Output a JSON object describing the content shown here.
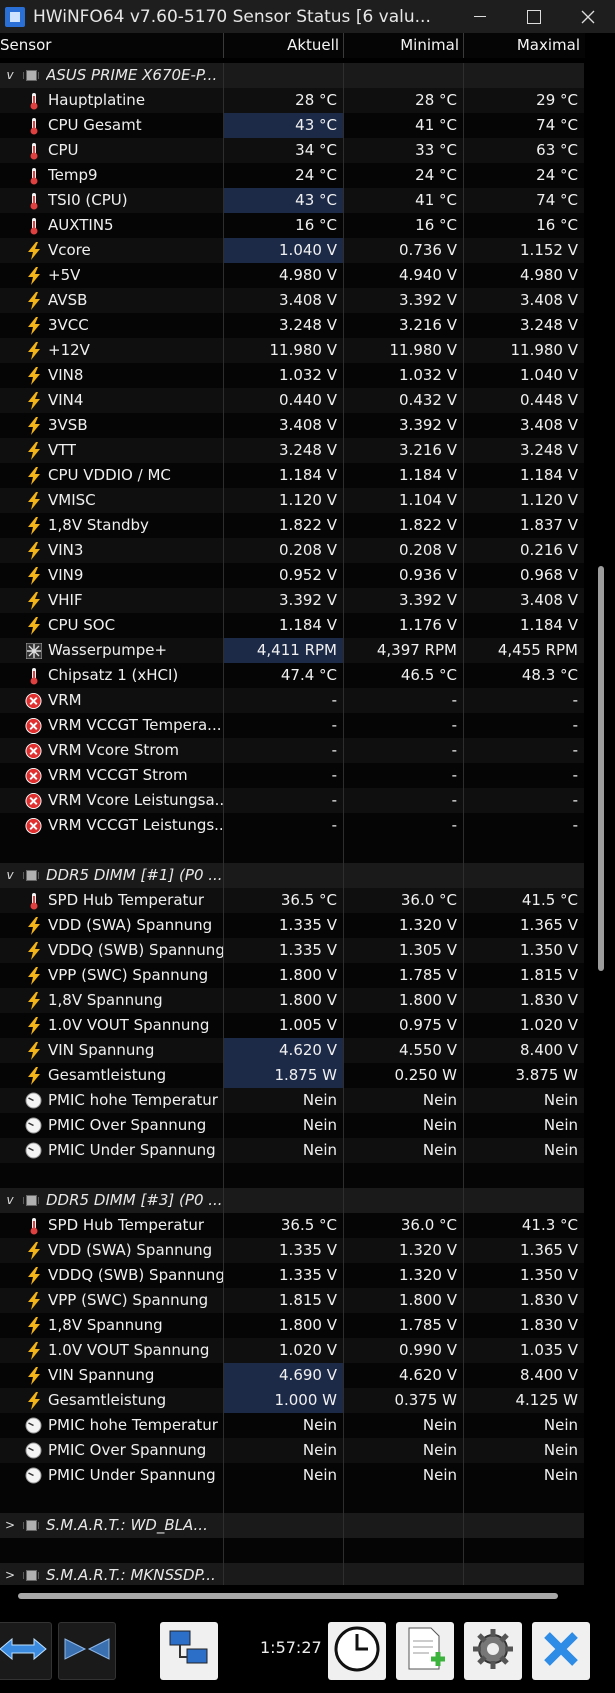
{
  "window": {
    "title": "HWiNFO64 v7.60-5170 Sensor Status [6 valu..."
  },
  "columns": [
    "Sensor",
    "Aktuell",
    "Minimal",
    "Maximal"
  ],
  "rows": [
    {
      "type": "group",
      "toggle": "v",
      "label": "ASUS PRIME X670E-P..."
    },
    {
      "type": "sensor",
      "icon": "thermometer-icon",
      "label": "Hauptplatine",
      "cur": "28 °C",
      "min": "28 °C",
      "max": "29 °C"
    },
    {
      "type": "sensor",
      "icon": "thermometer-icon",
      "label": "CPU Gesamt",
      "cur": "43 °C",
      "min": "41 °C",
      "max": "74 °C",
      "hl": true
    },
    {
      "type": "sensor",
      "icon": "thermometer-icon",
      "label": "CPU",
      "cur": "34 °C",
      "min": "33 °C",
      "max": "63 °C"
    },
    {
      "type": "sensor",
      "icon": "thermometer-icon",
      "label": "Temp9",
      "cur": "24 °C",
      "min": "24 °C",
      "max": "24 °C"
    },
    {
      "type": "sensor",
      "icon": "thermometer-icon",
      "label": "TSI0 (CPU)",
      "cur": "43 °C",
      "min": "41 °C",
      "max": "74 °C",
      "hl": true
    },
    {
      "type": "sensor",
      "icon": "thermometer-icon",
      "label": "AUXTIN5",
      "cur": "16 °C",
      "min": "16 °C",
      "max": "16 °C"
    },
    {
      "type": "sensor",
      "icon": "lightning-icon",
      "label": "Vcore",
      "cur": "1.040 V",
      "min": "0.736 V",
      "max": "1.152 V",
      "hl": true
    },
    {
      "type": "sensor",
      "icon": "lightning-icon",
      "label": "+5V",
      "cur": "4.980 V",
      "min": "4.940 V",
      "max": "4.980 V"
    },
    {
      "type": "sensor",
      "icon": "lightning-icon",
      "label": "AVSB",
      "cur": "3.408 V",
      "min": "3.392 V",
      "max": "3.408 V"
    },
    {
      "type": "sensor",
      "icon": "lightning-icon",
      "label": "3VCC",
      "cur": "3.248 V",
      "min": "3.216 V",
      "max": "3.248 V"
    },
    {
      "type": "sensor",
      "icon": "lightning-icon",
      "label": "+12V",
      "cur": "11.980 V",
      "min": "11.980 V",
      "max": "11.980 V"
    },
    {
      "type": "sensor",
      "icon": "lightning-icon",
      "label": "VIN8",
      "cur": "1.032 V",
      "min": "1.032 V",
      "max": "1.040 V"
    },
    {
      "type": "sensor",
      "icon": "lightning-icon",
      "label": "VIN4",
      "cur": "0.440 V",
      "min": "0.432 V",
      "max": "0.448 V"
    },
    {
      "type": "sensor",
      "icon": "lightning-icon",
      "label": "3VSB",
      "cur": "3.408 V",
      "min": "3.392 V",
      "max": "3.408 V"
    },
    {
      "type": "sensor",
      "icon": "lightning-icon",
      "label": "VTT",
      "cur": "3.248 V",
      "min": "3.216 V",
      "max": "3.248 V"
    },
    {
      "type": "sensor",
      "icon": "lightning-icon",
      "label": "CPU VDDIO / MC",
      "cur": "1.184 V",
      "min": "1.184 V",
      "max": "1.184 V"
    },
    {
      "type": "sensor",
      "icon": "lightning-icon",
      "label": "VMISC",
      "cur": "1.120 V",
      "min": "1.104 V",
      "max": "1.120 V"
    },
    {
      "type": "sensor",
      "icon": "lightning-icon",
      "label": "1,8V Standby",
      "cur": "1.822 V",
      "min": "1.822 V",
      "max": "1.837 V"
    },
    {
      "type": "sensor",
      "icon": "lightning-icon",
      "label": "VIN3",
      "cur": "0.208 V",
      "min": "0.208 V",
      "max": "0.216 V"
    },
    {
      "type": "sensor",
      "icon": "lightning-icon",
      "label": "VIN9",
      "cur": "0.952 V",
      "min": "0.936 V",
      "max": "0.968 V"
    },
    {
      "type": "sensor",
      "icon": "lightning-icon",
      "label": "VHIF",
      "cur": "3.392 V",
      "min": "3.392 V",
      "max": "3.408 V"
    },
    {
      "type": "sensor",
      "icon": "lightning-icon",
      "label": "CPU SOC",
      "cur": "1.184 V",
      "min": "1.176 V",
      "max": "1.184 V"
    },
    {
      "type": "sensor",
      "icon": "fan-icon",
      "label": "Wasserpumpe+",
      "cur": "4,411 RPM",
      "min": "4,397 RPM",
      "max": "4,455 RPM",
      "hl": true
    },
    {
      "type": "sensor",
      "icon": "thermometer-icon",
      "label": "Chipsatz 1 (xHCI)",
      "cur": "47.4 °C",
      "min": "46.5 °C",
      "max": "48.3 °C"
    },
    {
      "type": "sensor",
      "icon": "error-icon",
      "label": "VRM",
      "cur": "-",
      "min": "-",
      "max": "-"
    },
    {
      "type": "sensor",
      "icon": "error-icon",
      "label": "VRM VCCGT Tempera...",
      "cur": "-",
      "min": "-",
      "max": "-"
    },
    {
      "type": "sensor",
      "icon": "error-icon",
      "label": "VRM Vcore Strom",
      "cur": "-",
      "min": "-",
      "max": "-"
    },
    {
      "type": "sensor",
      "icon": "error-icon",
      "label": "VRM VCCGT Strom",
      "cur": "-",
      "min": "-",
      "max": "-"
    },
    {
      "type": "sensor",
      "icon": "error-icon",
      "label": "VRM Vcore Leistungsa...",
      "cur": "-",
      "min": "-",
      "max": "-"
    },
    {
      "type": "sensor",
      "icon": "error-icon",
      "label": "VRM VCCGT Leistungs...",
      "cur": "-",
      "min": "-",
      "max": "-"
    },
    {
      "type": "blank"
    },
    {
      "type": "group",
      "toggle": "v",
      "label": "DDR5 DIMM [#1] (P0 ..."
    },
    {
      "type": "sensor",
      "icon": "thermometer-icon",
      "label": "SPD Hub Temperatur",
      "cur": "36.5 °C",
      "min": "36.0 °C",
      "max": "41.5 °C"
    },
    {
      "type": "sensor",
      "icon": "lightning-icon",
      "label": "VDD (SWA) Spannung",
      "cur": "1.335 V",
      "min": "1.320 V",
      "max": "1.365 V"
    },
    {
      "type": "sensor",
      "icon": "lightning-icon",
      "label": "VDDQ (SWB) Spannung",
      "cur": "1.335 V",
      "min": "1.305 V",
      "max": "1.350 V"
    },
    {
      "type": "sensor",
      "icon": "lightning-icon",
      "label": "VPP (SWC) Spannung",
      "cur": "1.800 V",
      "min": "1.785 V",
      "max": "1.815 V"
    },
    {
      "type": "sensor",
      "icon": "lightning-icon",
      "label": "1,8V Spannung",
      "cur": "1.800 V",
      "min": "1.800 V",
      "max": "1.830 V"
    },
    {
      "type": "sensor",
      "icon": "lightning-icon",
      "label": "1.0V VOUT Spannung",
      "cur": "1.005 V",
      "min": "0.975 V",
      "max": "1.020 V"
    },
    {
      "type": "sensor",
      "icon": "lightning-icon",
      "label": "VIN Spannung",
      "cur": "4.620 V",
      "min": "4.550 V",
      "max": "8.400 V",
      "hl": true
    },
    {
      "type": "sensor",
      "icon": "lightning-icon",
      "label": "Gesamtleistung",
      "cur": "1.875 W",
      "min": "0.250 W",
      "max": "3.875 W",
      "hl": true
    },
    {
      "type": "sensor",
      "icon": "gauge-icon",
      "label": "PMIC hohe Temperatur",
      "cur": "Nein",
      "min": "Nein",
      "max": "Nein"
    },
    {
      "type": "sensor",
      "icon": "gauge-icon",
      "label": "PMIC Over Spannung",
      "cur": "Nein",
      "min": "Nein",
      "max": "Nein"
    },
    {
      "type": "sensor",
      "icon": "gauge-icon",
      "label": "PMIC Under Spannung",
      "cur": "Nein",
      "min": "Nein",
      "max": "Nein"
    },
    {
      "type": "blank"
    },
    {
      "type": "group",
      "toggle": "v",
      "label": "DDR5 DIMM [#3] (P0 ..."
    },
    {
      "type": "sensor",
      "icon": "thermometer-icon",
      "label": "SPD Hub Temperatur",
      "cur": "36.5 °C",
      "min": "36.0 °C",
      "max": "41.3 °C"
    },
    {
      "type": "sensor",
      "icon": "lightning-icon",
      "label": "VDD (SWA) Spannung",
      "cur": "1.335 V",
      "min": "1.320 V",
      "max": "1.365 V"
    },
    {
      "type": "sensor",
      "icon": "lightning-icon",
      "label": "VDDQ (SWB) Spannung",
      "cur": "1.335 V",
      "min": "1.320 V",
      "max": "1.350 V"
    },
    {
      "type": "sensor",
      "icon": "lightning-icon",
      "label": "VPP (SWC) Spannung",
      "cur": "1.815 V",
      "min": "1.800 V",
      "max": "1.830 V"
    },
    {
      "type": "sensor",
      "icon": "lightning-icon",
      "label": "1,8V Spannung",
      "cur": "1.800 V",
      "min": "1.785 V",
      "max": "1.830 V"
    },
    {
      "type": "sensor",
      "icon": "lightning-icon",
      "label": "1.0V VOUT Spannung",
      "cur": "1.020 V",
      "min": "0.990 V",
      "max": "1.035 V"
    },
    {
      "type": "sensor",
      "icon": "lightning-icon",
      "label": "VIN Spannung",
      "cur": "4.690 V",
      "min": "4.620 V",
      "max": "8.400 V",
      "hl": true
    },
    {
      "type": "sensor",
      "icon": "lightning-icon",
      "label": "Gesamtleistung",
      "cur": "1.000 W",
      "min": "0.375 W",
      "max": "4.125 W",
      "hl": true
    },
    {
      "type": "sensor",
      "icon": "gauge-icon",
      "label": "PMIC hohe Temperatur",
      "cur": "Nein",
      "min": "Nein",
      "max": "Nein"
    },
    {
      "type": "sensor",
      "icon": "gauge-icon",
      "label": "PMIC Over Spannung",
      "cur": "Nein",
      "min": "Nein",
      "max": "Nein"
    },
    {
      "type": "sensor",
      "icon": "gauge-icon",
      "label": "PMIC Under Spannung",
      "cur": "Nein",
      "min": "Nein",
      "max": "Nein"
    },
    {
      "type": "blank"
    },
    {
      "type": "group",
      "toggle": ">",
      "label": "S.M.A.R.T.: WD_BLA..."
    },
    {
      "type": "blank"
    },
    {
      "type": "group",
      "toggle": ">",
      "label": "S.M.A.R.T.: MKNSSDP..."
    }
  ],
  "toolbar": {
    "time": "1:57:27",
    "buttons": [
      "expand-arrows-icon",
      "collapse-arrows-icon",
      "network-icon",
      "clock-icon",
      "report-icon",
      "settings-gear-icon",
      "close-x-icon"
    ]
  },
  "colors": {
    "highlight": "#1c2a48",
    "accent_blue": "#3a8be0",
    "thermometer_red": "#e04040",
    "lightning_yellow": "#f2b418",
    "error_red": "#e03030"
  }
}
